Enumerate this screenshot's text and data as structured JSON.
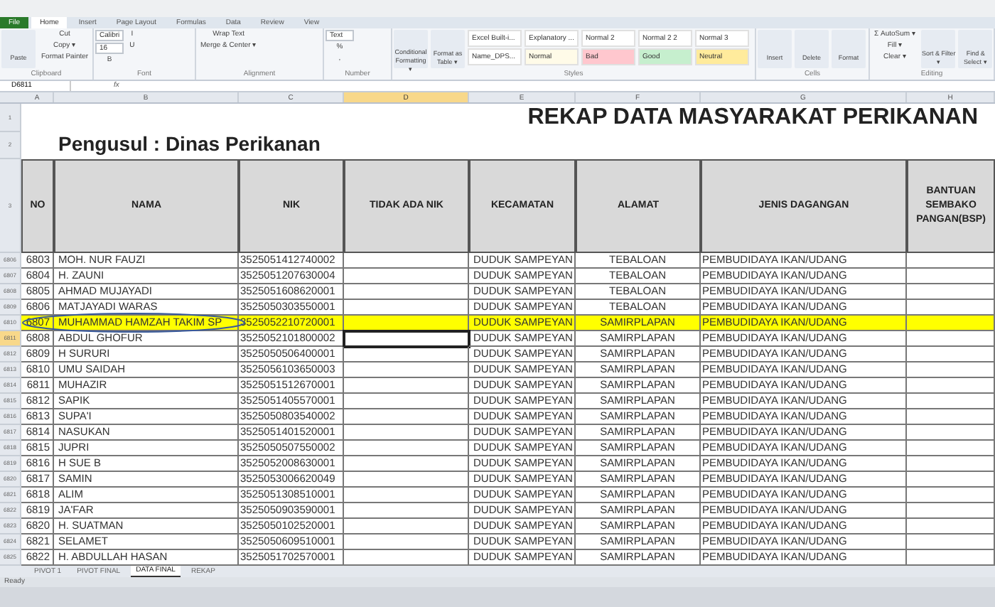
{
  "ribbon": {
    "tabs": [
      {
        "label": "File",
        "selected": false
      },
      {
        "label": "Home",
        "selected": true
      },
      {
        "label": "Insert",
        "selected": false
      },
      {
        "label": "Page Layout",
        "selected": false
      },
      {
        "label": "Formulas",
        "selected": false
      },
      {
        "label": "Data",
        "selected": false
      },
      {
        "label": "Review",
        "selected": false
      },
      {
        "label": "View",
        "selected": false
      }
    ],
    "groups": [
      {
        "title": "Clipboard",
        "items": [
          {
            "kind": "big",
            "label": "Paste"
          },
          {
            "kind": "small",
            "label": "Cut"
          },
          {
            "kind": "small",
            "label": "Copy ▾"
          },
          {
            "kind": "small",
            "label": "Format Painter"
          }
        ]
      },
      {
        "title": "Font",
        "items": [
          {
            "kind": "field",
            "label": "Calibri"
          },
          {
            "kind": "field",
            "label": "16"
          },
          {
            "kind": "small",
            "label": "B"
          },
          {
            "kind": "small",
            "label": "I"
          },
          {
            "kind": "small",
            "label": "U"
          }
        ]
      },
      {
        "title": "Alignment",
        "items": [
          {
            "kind": "small",
            "label": "Wrap Text"
          },
          {
            "kind": "small",
            "label": "Merge & Center ▾"
          }
        ]
      },
      {
        "title": "Number",
        "items": [
          {
            "kind": "field",
            "label": "Text"
          },
          {
            "kind": "small",
            "label": "%"
          },
          {
            "kind": "small",
            "label": ","
          }
        ]
      },
      {
        "title": "Styles",
        "items": [
          {
            "kind": "big",
            "label": "Conditional Formatting ▾"
          },
          {
            "kind": "big",
            "label": "Format as Table ▾"
          },
          {
            "kind": "style",
            "label": "Excel Built-i...",
            "color": "#ffffff"
          },
          {
            "kind": "style",
            "label": "Name_DPS...",
            "color": "#ffffff"
          },
          {
            "kind": "style",
            "label": "Explanatory ...",
            "color": "#ffffff"
          },
          {
            "kind": "style",
            "label": "Normal",
            "color": "#fffbe8"
          },
          {
            "kind": "style",
            "label": "Normal 2",
            "color": "#ffffff"
          },
          {
            "kind": "style",
            "label": "Bad",
            "color": "#ffc7ce"
          },
          {
            "kind": "style",
            "label": "Normal 2 2",
            "color": "#ffffff"
          },
          {
            "kind": "style",
            "label": "Good",
            "color": "#c6efce"
          },
          {
            "kind": "style",
            "label": "Normal 3",
            "color": "#ffffff"
          },
          {
            "kind": "style",
            "label": "Neutral",
            "color": "#ffeb9c"
          }
        ]
      },
      {
        "title": "Cells",
        "items": [
          {
            "kind": "big",
            "label": "Insert"
          },
          {
            "kind": "big",
            "label": "Delete"
          },
          {
            "kind": "big",
            "label": "Format"
          }
        ]
      },
      {
        "title": "Editing",
        "items": [
          {
            "kind": "small",
            "label": "Σ AutoSum ▾"
          },
          {
            "kind": "small",
            "label": "Fill ▾"
          },
          {
            "kind": "small",
            "label": "Clear ▾"
          },
          {
            "kind": "big",
            "label": "Sort & Filter ▾"
          },
          {
            "kind": "big",
            "label": "Find & Select ▾"
          }
        ]
      }
    ]
  },
  "formula_bar": {
    "name_box": "D6811",
    "fx": "fx"
  },
  "column_headers": [
    {
      "label": "A",
      "selected": false
    },
    {
      "label": "B",
      "selected": false
    },
    {
      "label": "C",
      "selected": false
    },
    {
      "label": "D",
      "selected": true
    },
    {
      "label": "E",
      "selected": false
    },
    {
      "label": "F",
      "selected": false
    },
    {
      "label": "G",
      "selected": false
    },
    {
      "label": "H",
      "selected": false
    }
  ],
  "title": "REKAP DATA MASYARAKAT PERIKANAN",
  "subtitle": "Pengusul : Dinas Perikanan",
  "top_row_numbers": [
    "1",
    "2",
    "3"
  ],
  "table": {
    "columns": [
      "NO",
      "NAMA",
      "NIK",
      "TIDAK ADA NIK",
      "KECAMATAN",
      "ALAMAT",
      "JENIS DAGANGAN",
      "BANTUAN SEMBAKO PANGAN(BSP)"
    ],
    "rows": [
      {
        "row_number": "6806",
        "no": "6803",
        "nama": "MOH. NUR FAUZI",
        "nik": "3525051412740002",
        "kecamatan": "DUDUK SAMPEYAN",
        "alamat": "TEBALOAN",
        "jenis": "PEMBUDIDAYA IKAN/UDANG",
        "highlighted": false,
        "selected": false
      },
      {
        "row_number": "6807",
        "no": "6804",
        "nama": "H. ZAUNI",
        "nik": "3525051207630004",
        "kecamatan": "DUDUK SAMPEYAN",
        "alamat": "TEBALOAN",
        "jenis": "PEMBUDIDAYA IKAN/UDANG",
        "highlighted": false,
        "selected": false
      },
      {
        "row_number": "6808",
        "no": "6805",
        "nama": "AHMAD MUJAYADI",
        "nik": "3525051608620001",
        "kecamatan": "DUDUK SAMPEYAN",
        "alamat": "TEBALOAN",
        "jenis": "PEMBUDIDAYA IKAN/UDANG",
        "highlighted": false,
        "selected": false
      },
      {
        "row_number": "6809",
        "no": "6806",
        "nama": "MATJAYADI WARAS",
        "nik": "3525050303550001",
        "kecamatan": "DUDUK SAMPEYAN",
        "alamat": "TEBALOAN",
        "jenis": "PEMBUDIDAYA IKAN/UDANG",
        "highlighted": false,
        "selected": false
      },
      {
        "row_number": "6810",
        "no": "6807",
        "nama": "MUHAMMAD HAMZAH TAKIM SP",
        "nik": "3525052210720001",
        "kecamatan": "DUDUK SAMPEYAN",
        "alamat": "SAMIRPLAPAN",
        "jenis": "PEMBUDIDAYA IKAN/UDANG",
        "highlighted": true,
        "selected": false
      },
      {
        "row_number": "6811",
        "no": "6808",
        "nama": "ABDUL GHOFUR",
        "nik": "3525052101800002",
        "kecamatan": "DUDUK SAMPEYAN",
        "alamat": "SAMIRPLAPAN",
        "jenis": "PEMBUDIDAYA IKAN/UDANG",
        "highlighted": false,
        "selected": true
      },
      {
        "row_number": "6812",
        "no": "6809",
        "nama": "H SURURI",
        "nik": "3525050506400001",
        "kecamatan": "DUDUK SAMPEYAN",
        "alamat": "SAMIRPLAPAN",
        "jenis": "PEMBUDIDAYA IKAN/UDANG",
        "highlighted": false,
        "selected": false
      },
      {
        "row_number": "6813",
        "no": "6810",
        "nama": "UMU SAIDAH",
        "nik": "3525056103650003",
        "kecamatan": "DUDUK SAMPEYAN",
        "alamat": "SAMIRPLAPAN",
        "jenis": "PEMBUDIDAYA IKAN/UDANG",
        "highlighted": false,
        "selected": false
      },
      {
        "row_number": "6814",
        "no": "6811",
        "nama": "MUHAZIR",
        "nik": "3525051512670001",
        "kecamatan": "DUDUK SAMPEYAN",
        "alamat": "SAMIRPLAPAN",
        "jenis": "PEMBUDIDAYA IKAN/UDANG",
        "highlighted": false,
        "selected": false
      },
      {
        "row_number": "6815",
        "no": "6812",
        "nama": "SAPIK",
        "nik": "3525051405570001",
        "kecamatan": "DUDUK SAMPEYAN",
        "alamat": "SAMIRPLAPAN",
        "jenis": "PEMBUDIDAYA IKAN/UDANG",
        "highlighted": false,
        "selected": false
      },
      {
        "row_number": "6816",
        "no": "6813",
        "nama": "SUPA'I",
        "nik": "3525050803540002",
        "kecamatan": "DUDUK SAMPEYAN",
        "alamat": "SAMIRPLAPAN",
        "jenis": "PEMBUDIDAYA IKAN/UDANG",
        "highlighted": false,
        "selected": false
      },
      {
        "row_number": "6817",
        "no": "6814",
        "nama": "NASUKAN",
        "nik": "3525051401520001",
        "kecamatan": "DUDUK SAMPEYAN",
        "alamat": "SAMIRPLAPAN",
        "jenis": "PEMBUDIDAYA IKAN/UDANG",
        "highlighted": false,
        "selected": false
      },
      {
        "row_number": "6818",
        "no": "6815",
        "nama": "JUPRI",
        "nik": "3525050507550002",
        "kecamatan": "DUDUK SAMPEYAN",
        "alamat": "SAMIRPLAPAN",
        "jenis": "PEMBUDIDAYA IKAN/UDANG",
        "highlighted": false,
        "selected": false
      },
      {
        "row_number": "6819",
        "no": "6816",
        "nama": "H SUE B",
        "nik": "3525052008630001",
        "kecamatan": "DUDUK SAMPEYAN",
        "alamat": "SAMIRPLAPAN",
        "jenis": "PEMBUDIDAYA IKAN/UDANG",
        "highlighted": false,
        "selected": false
      },
      {
        "row_number": "6820",
        "no": "6817",
        "nama": "SAMIN",
        "nik": "3525053006620049",
        "kecamatan": "DUDUK SAMPEYAN",
        "alamat": "SAMIRPLAPAN",
        "jenis": "PEMBUDIDAYA IKAN/UDANG",
        "highlighted": false,
        "selected": false
      },
      {
        "row_number": "6821",
        "no": "6818",
        "nama": "ALIM",
        "nik": "3525051308510001",
        "kecamatan": "DUDUK SAMPEYAN",
        "alamat": "SAMIRPLAPAN",
        "jenis": "PEMBUDIDAYA IKAN/UDANG",
        "highlighted": false,
        "selected": false
      },
      {
        "row_number": "6822",
        "no": "6819",
        "nama": "JA'FAR",
        "nik": "3525050903590001",
        "kecamatan": "DUDUK SAMPEYAN",
        "alamat": "SAMIRPLAPAN",
        "jenis": "PEMBUDIDAYA IKAN/UDANG",
        "highlighted": false,
        "selected": false
      },
      {
        "row_number": "6823",
        "no": "6820",
        "nama": "H. SUATMAN",
        "nik": "3525050102520001",
        "kecamatan": "DUDUK SAMPEYAN",
        "alamat": "SAMIRPLAPAN",
        "jenis": "PEMBUDIDAYA IKAN/UDANG",
        "highlighted": false,
        "selected": false
      },
      {
        "row_number": "6824",
        "no": "6821",
        "nama": "SELAMET",
        "nik": "3525050609510001",
        "kecamatan": "DUDUK SAMPEYAN",
        "alamat": "SAMIRPLAPAN",
        "jenis": "PEMBUDIDAYA IKAN/UDANG",
        "highlighted": false,
        "selected": false
      },
      {
        "row_number": "6825",
        "no": "6822",
        "nama": "H. ABDULLAH HASAN",
        "nik": "3525051702570001",
        "kecamatan": "DUDUK SAMPEYAN",
        "alamat": "SAMIRPLAPAN",
        "jenis": "PEMBUDIDAYA IKAN/UDANG",
        "highlighted": false,
        "selected": false
      }
    ]
  },
  "sheet_tabs": [
    {
      "label": "PIVOT 1",
      "selected": false
    },
    {
      "label": "PIVOT FINAL",
      "selected": false
    },
    {
      "label": "DATA FINAL",
      "selected": true
    },
    {
      "label": "REKAP",
      "selected": false
    }
  ],
  "status_bar": {
    "status": "Ready"
  }
}
